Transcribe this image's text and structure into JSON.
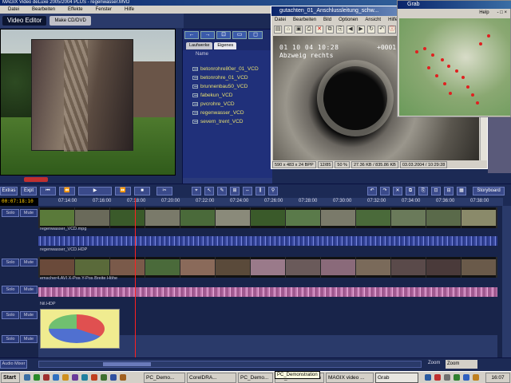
{
  "magix": {
    "title": "MAGIX Video deLuxe 2005/2004 PLUS - regenwasser.MVD",
    "menu": [
      "Datei",
      "Bearbeiten",
      "Effekte",
      "Fenster",
      "Hilfe"
    ],
    "tabs": {
      "video_editor": "Video Editor",
      "make_cd": "Make CD/DVD"
    }
  },
  "browser": {
    "toolbar": [
      "←",
      "→",
      "⊡",
      "▭",
      "◻"
    ],
    "tabs": [
      "Laufwerke",
      "Eigenes"
    ],
    "column": "Name",
    "items": [
      "betonrohre80er_01_VCD",
      "betonrohre_01_VCD",
      "brunnenbau50_VCD",
      "fabekun_VCD",
      "pvcrohre_VCD",
      "regenwasser_VCD",
      "severn_trent_VCD"
    ]
  },
  "viewer": {
    "title": "gutachten_01_Anschlussleitung_schw...",
    "menu": [
      "Datei",
      "Bearbeiten",
      "Bild",
      "Optionen",
      "Ansicht",
      "Hilfe"
    ],
    "osd_date": "01 10 04  10:28",
    "osd_text": "Abzweig rechts",
    "osd_counter": "+0001",
    "status": [
      "590 x 483 x 24 BPP",
      "12/85",
      "50 %",
      "27.36 KB / 835.86 KB",
      "03.03.2004 / 10:29:28"
    ]
  },
  "grab": {
    "title": "Grab",
    "menu": [
      "Help",
      "- □ ×"
    ]
  },
  "tools": {
    "export": "Expt",
    "extras": "Extras",
    "storyboard": "Storyboard"
  },
  "timeline": {
    "timecode": "00:07:18:10",
    "ticks": [
      "07:14:00",
      "07:16:00",
      "07:18:00",
      "07:20:00",
      "07:22:00",
      "07:24:00",
      "07:26:00",
      "07:28:00",
      "07:30:00",
      "07:32:00",
      "07:34:00",
      "07:36:00",
      "07:38:00"
    ],
    "solo": "Solo",
    "mute": "Mute",
    "clip1": "regenwasser_VCD.mpg",
    "clip2": "regenwasser_VCD.HDP",
    "clip3": "emscher4.AVI   X-Pos   Y-Pos   Breite   Höhe",
    "clip4": "Nil.HDP",
    "audio_mixer": "Audio Mixer",
    "zoom_label": "Zoom",
    "zoom_value": "Zoom"
  },
  "taskbar": {
    "start": "Start",
    "items": [
      "PC_Demo...",
      "CorelDRA...",
      "PC_Demo...",
      "PC_Demonstration",
      "MAGIX video ...",
      "Grab"
    ],
    "clock": "16:07",
    "tooltip": "PC_Demonstration"
  }
}
